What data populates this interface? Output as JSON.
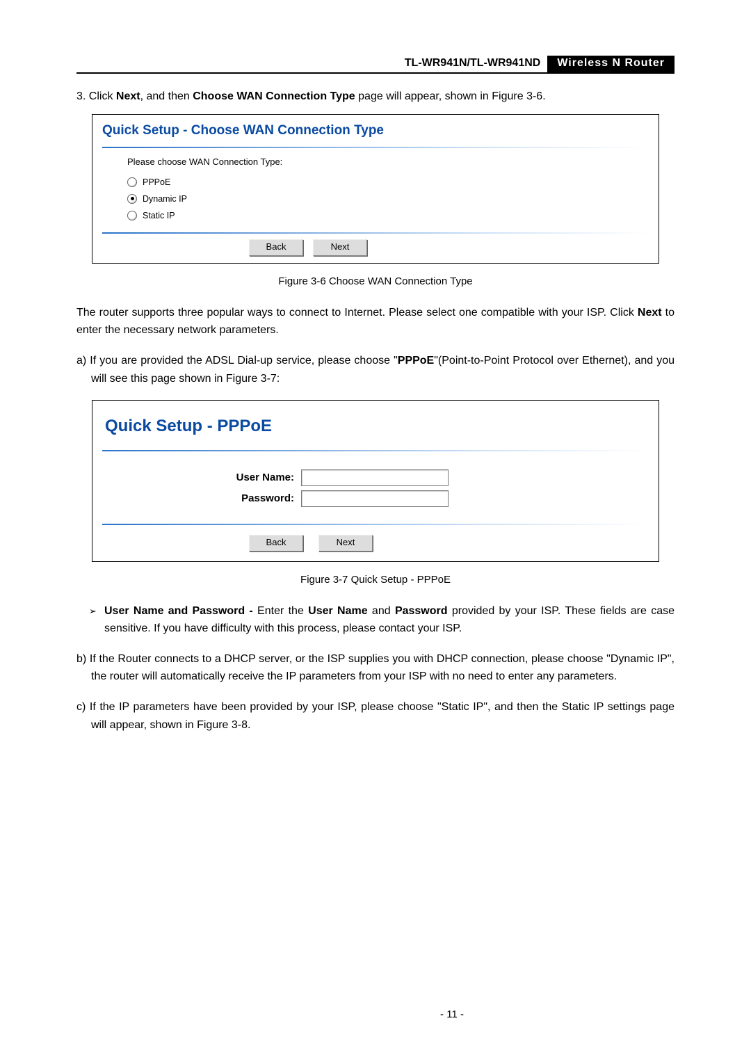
{
  "header": {
    "model": "TL-WR941N/TL-WR941ND",
    "device": "Wireless  N  Router"
  },
  "step3": {
    "prefix": "3. Click ",
    "bold1": "Next",
    "mid1": ", and then ",
    "bold2": "Choose WAN Connection Type",
    "suffix": " page will appear, shown in Figure 3-6."
  },
  "fig36": {
    "title": "Quick Setup - Choose WAN Connection Type",
    "prompt": "Please choose WAN Connection Type:",
    "options": {
      "pppoe": "PPPoE",
      "dynamic": "Dynamic IP",
      "static": "Static IP"
    },
    "back": "Back",
    "next": "Next",
    "caption": "Figure 3-6    Choose WAN Connection Type"
  },
  "para1": {
    "p1a": "The router supports three popular ways to connect to Internet. Please select one compatible with your ISP. Click ",
    "bold": "Next",
    "p1b": " to enter the necessary network parameters."
  },
  "item_a": {
    "a1": "a) If you are provided the ADSL Dial-up service, please choose \"",
    "bold": "PPPoE",
    "a2": "\"(Point-to-Point Protocol over Ethernet), and you will see this page shown in Figure 3-7:"
  },
  "fig37": {
    "title": "Quick Setup - PPPoE",
    "user_label": "User Name:",
    "pass_label": "Password:",
    "back": "Back",
    "next": "Next",
    "caption": "Figure 3-7    Quick Setup - PPPoE"
  },
  "bullet": {
    "b1": "User Name and Password -",
    "b2": " Enter the ",
    "b3": "User Name",
    "b4": " and ",
    "b5": "Password",
    "b6": " provided by your ISP. These fields are case sensitive. If you have difficulty with this process, please contact your ISP."
  },
  "item_b": "b) If the Router connects to a DHCP server, or the ISP supplies you with DHCP connection, please choose \"Dynamic IP\", the router will automatically receive the IP parameters from your ISP with no need to enter any parameters.",
  "item_c": "c) If the IP parameters have been provided by your ISP, please choose \"Static IP\", and then the Static IP settings page will appear, shown in Figure 3-8.",
  "page_number": "- 11 -"
}
